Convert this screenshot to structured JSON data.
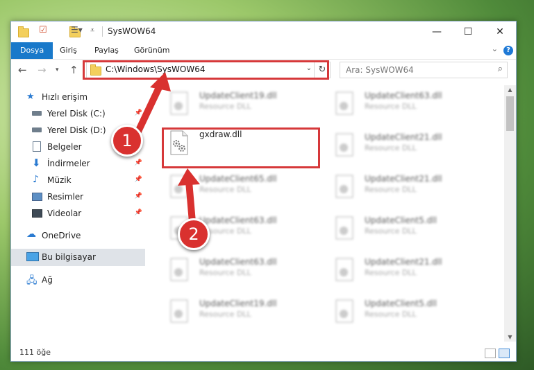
{
  "window": {
    "title": "SysWOW64",
    "controls": {
      "minimize": "—",
      "maximize": "☐",
      "close": "✕"
    }
  },
  "ribbon": {
    "tabs": [
      {
        "label": "Dosya",
        "active": true
      },
      {
        "label": "Giriş"
      },
      {
        "label": "Paylaş"
      },
      {
        "label": "Görünüm"
      }
    ],
    "help": "?"
  },
  "nav": {
    "address": "C:\\Windows\\SysWOW64",
    "search_placeholder": "Ara: SysWOW64"
  },
  "sidebar": {
    "items": [
      {
        "label": "Hızlı erişim",
        "icon": "star-icon"
      },
      {
        "label": "Yerel Disk (C:)",
        "icon": "drive-icon",
        "pinned": true
      },
      {
        "label": "Yerel Disk (D:)",
        "icon": "drive-icon",
        "pinned": true
      },
      {
        "label": "Belgeler",
        "icon": "documents-icon",
        "pinned": true
      },
      {
        "label": "İndirmeler",
        "icon": "download-icon",
        "pinned": true
      },
      {
        "label": "Müzik",
        "icon": "music-icon",
        "pinned": true
      },
      {
        "label": "Resimler",
        "icon": "pictures-icon",
        "pinned": true
      },
      {
        "label": "Videolar",
        "icon": "videos-icon",
        "pinned": true
      },
      {
        "label": "OneDrive",
        "icon": "cloud-icon"
      },
      {
        "label": "Bu bilgisayar",
        "icon": "computer-icon",
        "selected": true
      },
      {
        "label": "Ağ",
        "icon": "network-icon"
      }
    ]
  },
  "files": {
    "left_column": [
      {
        "name": "UpdateClient19.dll",
        "type": "Resource DLL"
      },
      {
        "name": "gxdraw.dll",
        "type": ""
      },
      {
        "name": "UpdateClient65.dll",
        "type": "Resource DLL"
      },
      {
        "name": "UpdateClient63.dll",
        "type": "Resource DLL"
      },
      {
        "name": "UpdateClient63.dll",
        "type": "Resource DLL"
      },
      {
        "name": "UpdateClient19.dll",
        "type": "Resource DLL"
      }
    ],
    "right_column": [
      {
        "name": "UpdateClient63.dll",
        "type": "Resource DLL"
      },
      {
        "name": "UpdateClient21.dll",
        "type": "Resource DLL"
      },
      {
        "name": "UpdateClient21.dll",
        "type": "Resource DLL"
      },
      {
        "name": "UpdateClient5.dll",
        "type": "Resource DLL"
      },
      {
        "name": "UpdateClient21.dll",
        "type": "Resource DLL"
      },
      {
        "name": "UpdateClient5.dll",
        "type": "Resource DLL"
      }
    ]
  },
  "status": {
    "count": "111 öğe"
  },
  "annotations": {
    "step1": "1",
    "step2": "2"
  },
  "colors": {
    "accent": "#1979ca",
    "highlight": "#d6383a"
  }
}
